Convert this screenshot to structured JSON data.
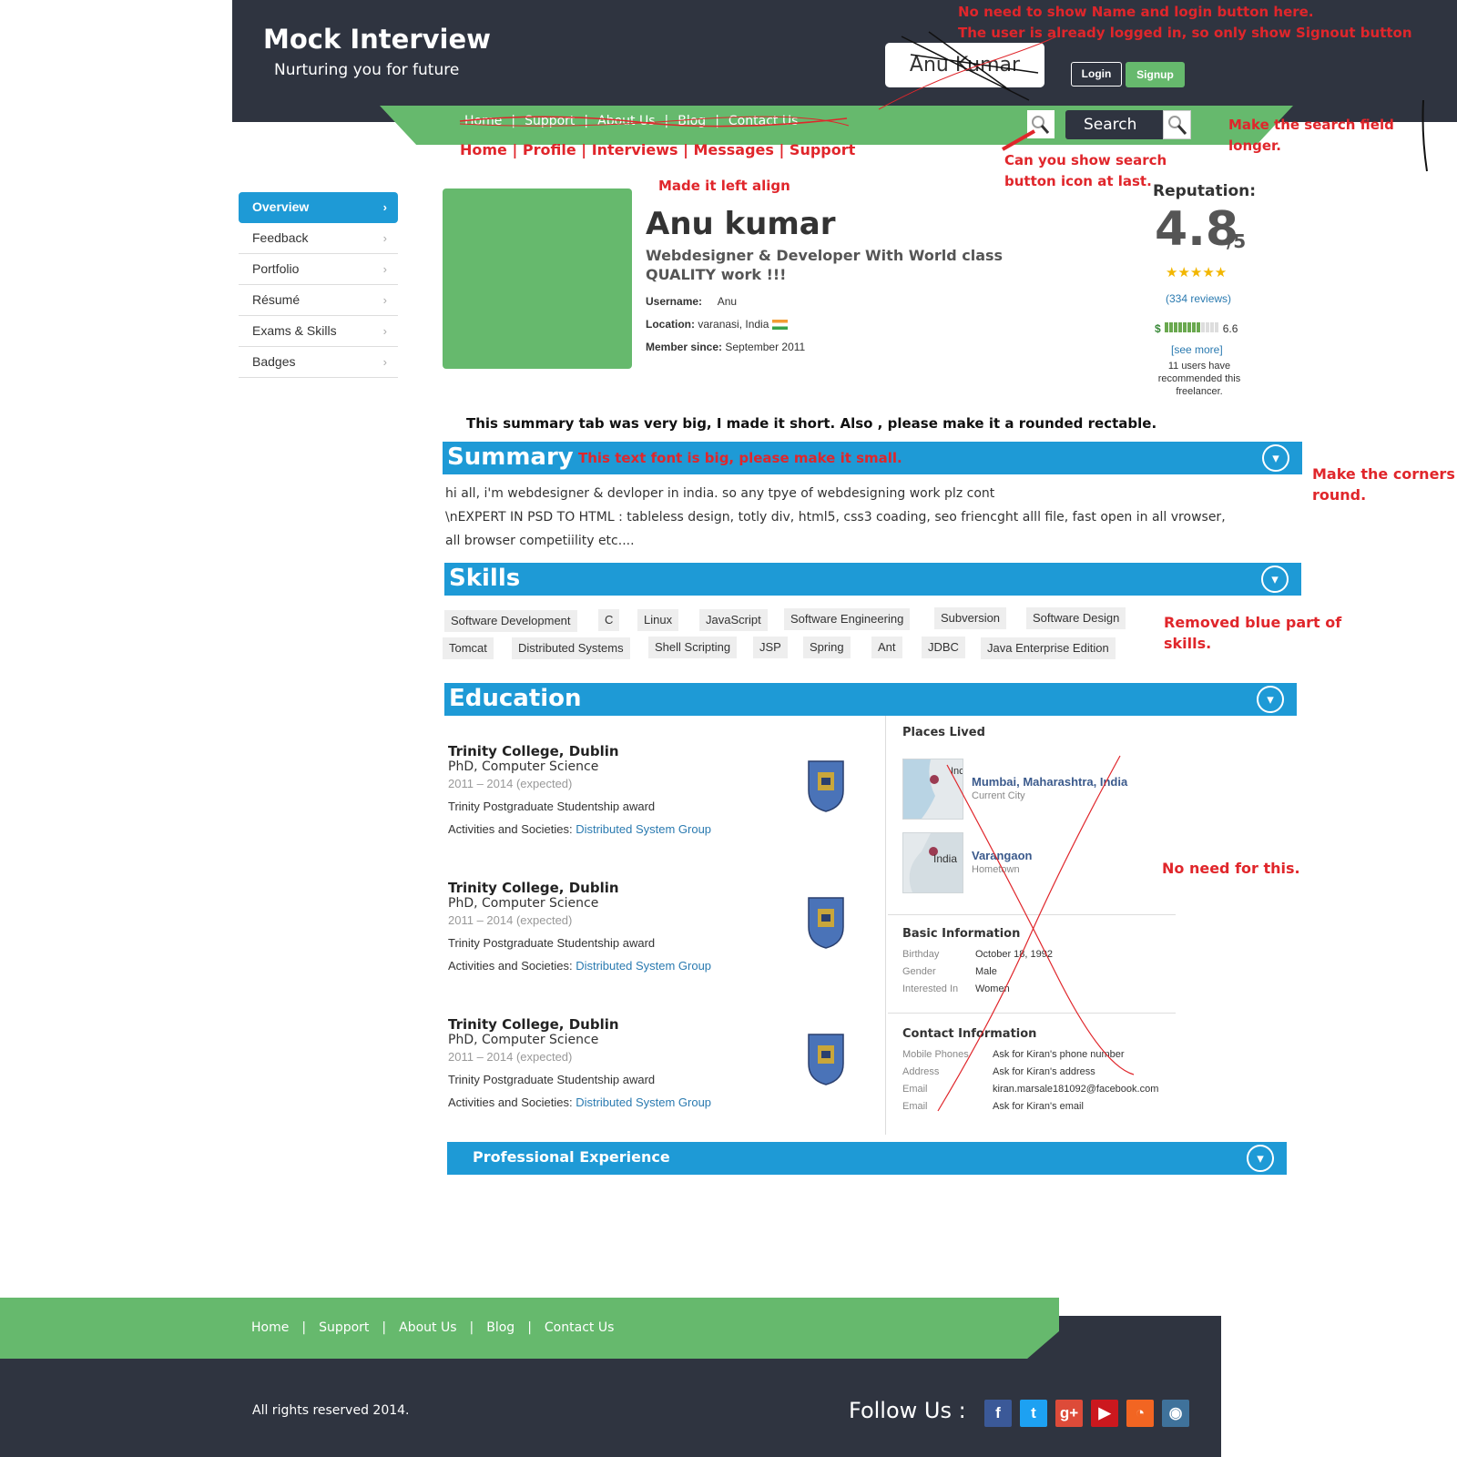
{
  "header": {
    "brand_title": "Mock Interview",
    "brand_tagline": "Nurturing you for future",
    "user_name": "Anu Kumar",
    "login_label": "Login",
    "signup_label": "Signup",
    "nav_links": [
      "Home",
      "Support",
      "About Us",
      "Blog",
      "Contact Us"
    ],
    "search_label": "Search",
    "new_nav_links": [
      "Home",
      "Profile",
      "Interviews",
      "Messages",
      "Support"
    ]
  },
  "annotations": {
    "name_login": "No need to show Name and login button here.",
    "signout": "The user is already logged in, so only show Signout button",
    "search_longer_1": "Make the search field",
    "search_longer_2": "longer.",
    "search_icon_1": "Can you show search",
    "search_icon_2": "button icon at last.",
    "left_align": "Made it left align",
    "summary_short": "This summary tab was very big, I made it short. Also , please make it a rounded rectable.",
    "summary_font": "This text font is big, please make it small.",
    "corners_1": "Make the corners",
    "corners_2": "round.",
    "skills_blue_1": "Removed blue part of",
    "skills_blue_2": "skills.",
    "no_need": "No need for this."
  },
  "sidebar": {
    "items": [
      {
        "label": "Overview",
        "active": true
      },
      {
        "label": "Feedback"
      },
      {
        "label": "Portfolio"
      },
      {
        "label": "Résumé"
      },
      {
        "label": "Exams & Skills"
      },
      {
        "label": "Badges"
      }
    ]
  },
  "profile": {
    "name": "Anu kumar",
    "headline": "Webdesigner & Developer With World class QUALITY work !!!",
    "username_label": "Username:",
    "username": "Anu",
    "location_label": "Location:",
    "location": "varanasi, India",
    "member_label": "Member since:",
    "member_since": "September 2011"
  },
  "reputation": {
    "label": "Reputation:",
    "score": "4.8",
    "out_of": "/5",
    "stars": 5,
    "reviews": "(334 reviews)",
    "currency": "$",
    "bar_level": 0.66,
    "bar_value": "6.6",
    "see_more": "[see more]",
    "recommend": "11 users have recommended this freelancer."
  },
  "sections": {
    "summary": "Summary",
    "skills": "Skills",
    "education": "Education",
    "experience": "Professional Experience"
  },
  "summary_text": [
    "hi all, i'm webdesigner & devloper in india. so any tpye of webdesigning work plz cont",
    "\\nEXPERT IN PSD TO HTML : tableless design, totly div, html5, css3 coading, seo friencght alll file, fast open in all vrowser,",
    "all browser competiility etc...."
  ],
  "skills": [
    "Software Development",
    "C",
    "Linux",
    "JavaScript",
    "Software Engineering",
    "Subversion",
    "Software Design",
    "Tomcat",
    "Distributed Systems",
    "Shell Scripting",
    "JSP",
    "Spring",
    "Ant",
    "JDBC",
    "Java Enterprise Edition"
  ],
  "education": [
    {
      "school": "Trinity College, Dublin",
      "degree": "PhD, Computer Science",
      "years": "2011 – 2014 (expected)",
      "award": "Trinity Postgraduate Studentship award",
      "act_label": "Activities and Societies:",
      "act_link": "Distributed System Group"
    },
    {
      "school": "Trinity College, Dublin",
      "degree": "PhD, Computer Science",
      "years": "2011 – 2014 (expected)",
      "award": "Trinity Postgraduate Studentship award",
      "act_label": "Activities and Societies:",
      "act_link": "Distributed System Group"
    },
    {
      "school": "Trinity College, Dublin",
      "degree": "PhD, Computer Science",
      "years": "2011 – 2014 (expected)",
      "award": "Trinity Postgraduate Studentship award",
      "act_label": "Activities and Societies:",
      "act_link": "Distributed System Group"
    }
  ],
  "places": {
    "title": "Places Lived",
    "items": [
      {
        "place": "Mumbai, Maharashtra, India",
        "kind": "Current City",
        "map_text": "Inc"
      },
      {
        "place": "Varangaon",
        "kind": "Hometown",
        "map_text": "India"
      }
    ]
  },
  "basic_info": {
    "title": "Basic Information",
    "rows": [
      {
        "label": "Birthday",
        "value": "October 18, 1992"
      },
      {
        "label": "Gender",
        "value": "Male"
      },
      {
        "label": "Interested In",
        "value": "Women"
      }
    ]
  },
  "contact_info": {
    "title": "Contact Information",
    "rows": [
      {
        "label": "Mobile Phones",
        "value": "Ask for Kiran's phone number"
      },
      {
        "label": "Address",
        "value": "Ask for Kiran's address"
      },
      {
        "label": "Email",
        "value": "kiran.marsale181092@facebook.com"
      },
      {
        "label": "Email",
        "value": "Ask for Kiran's email"
      }
    ]
  },
  "footer": {
    "links": [
      "Home",
      "Support",
      "About Us",
      "Blog",
      "Contact Us"
    ],
    "copyright": "All rights reserved 2014.",
    "follow": "Follow Us :",
    "social": [
      {
        "icon": "facebook-icon",
        "glyph": "f",
        "color": "#3b5998"
      },
      {
        "icon": "twitter-icon",
        "glyph": "t",
        "color": "#1da1f2"
      },
      {
        "icon": "google-plus-icon",
        "glyph": "g+",
        "color": "#dd4b39"
      },
      {
        "icon": "youtube-icon",
        "glyph": "▶",
        "color": "#cc181e"
      },
      {
        "icon": "rss-icon",
        "glyph": "◔",
        "color": "#f26522"
      },
      {
        "icon": "instagram-icon",
        "glyph": "◉",
        "color": "#3f729b"
      }
    ]
  },
  "colors": {
    "header_dark": "#2f3440",
    "accent_green": "#66b96d",
    "section_blue": "#1e9ad6",
    "annotation_red": "#e0262b"
  }
}
